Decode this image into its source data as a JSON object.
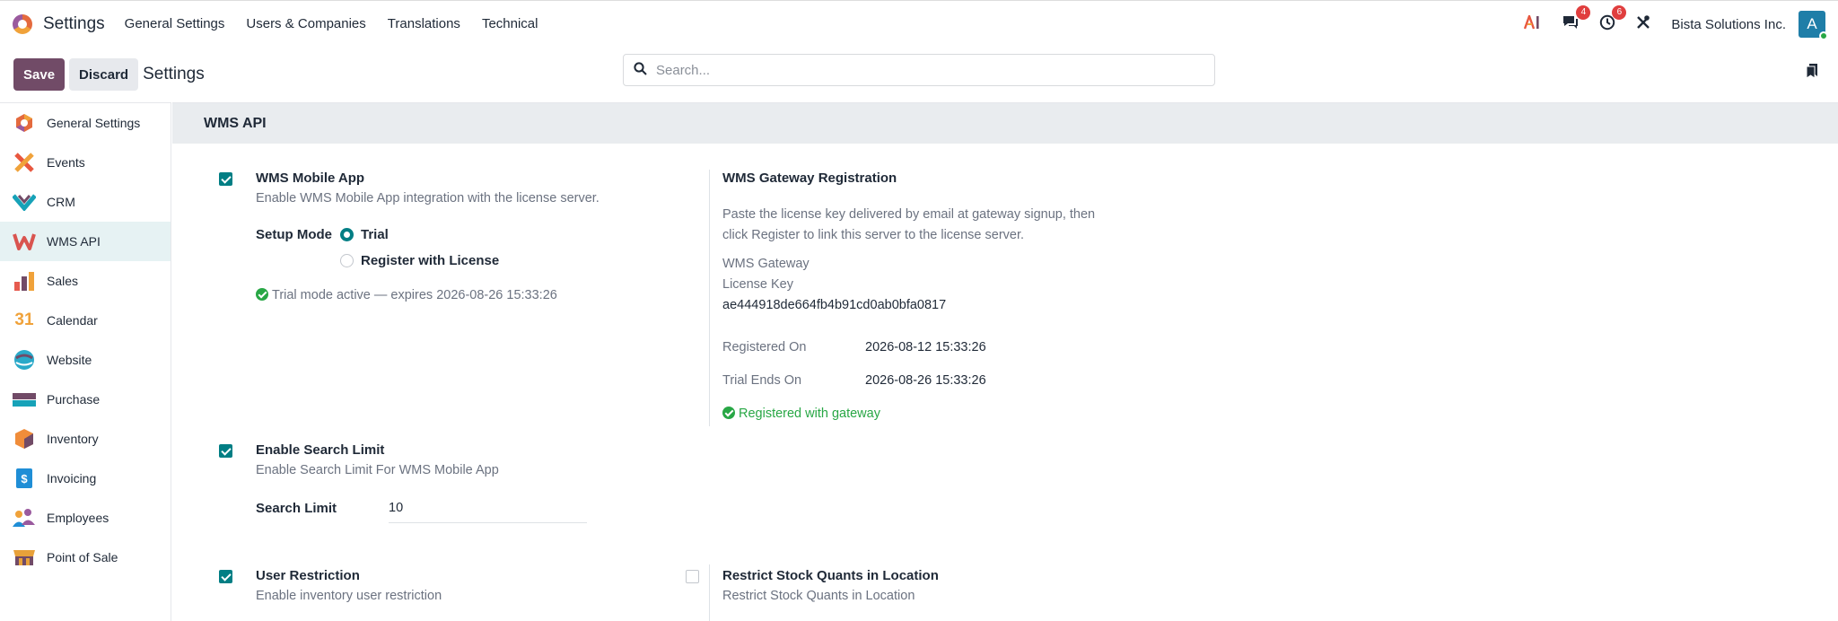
{
  "topnav": {
    "app_title": "Settings",
    "menu": [
      "General Settings",
      "Users & Companies",
      "Translations",
      "Technical"
    ],
    "messages_count": "4",
    "activities_count": "6",
    "company": "Bista Solutions Inc.",
    "avatar_letter": "A"
  },
  "control": {
    "save_label": "Save",
    "discard_label": "Discard",
    "title": "Settings",
    "search_placeholder": "Search..."
  },
  "sidebar": {
    "items": [
      {
        "label": "General Settings",
        "icon": "odoo-logo-icon",
        "color": "#e46a3e"
      },
      {
        "label": "Events",
        "icon": "events-icon",
        "color": "#e8573f"
      },
      {
        "label": "CRM",
        "icon": "crm-icon",
        "color": "#17a2b8"
      },
      {
        "label": "WMS API",
        "icon": "wms-api-icon",
        "color": "#d9544f"
      },
      {
        "label": "Sales",
        "icon": "sales-icon",
        "color": "#e65b4f"
      },
      {
        "label": "Calendar",
        "icon": "calendar-icon",
        "color": "#f0a23a"
      },
      {
        "label": "Website",
        "icon": "website-icon",
        "color": "#2aa9c9"
      },
      {
        "label": "Purchase",
        "icon": "purchase-icon",
        "color": "#714b67"
      },
      {
        "label": "Inventory",
        "icon": "inventory-icon",
        "color": "#f08d3a"
      },
      {
        "label": "Invoicing",
        "icon": "invoicing-icon",
        "color": "#1f8ed6"
      },
      {
        "label": "Employees",
        "icon": "employees-icon",
        "color": "#9a5a9e"
      },
      {
        "label": "Point of Sale",
        "icon": "point-of-sale-icon",
        "color": "#e8a13a"
      }
    ],
    "calendar_glyph": "31"
  },
  "main": {
    "section_title": "WMS API",
    "mobile_app": {
      "title": "WMS Mobile App",
      "desc": "Enable WMS Mobile App integration with the license server.",
      "setup_mode_label": "Setup Mode",
      "option_trial": "Trial",
      "option_register": "Register with License",
      "status": "Trial mode active — expires 2026-08-26 15:33:26"
    },
    "gateway": {
      "title": "WMS Gateway Registration",
      "desc_line1": "Paste the license key delivered by email at gateway signup, then",
      "desc_line2": "click Register to link this server to the license server.",
      "key_label_line1": "WMS Gateway",
      "key_label_line2": "License Key",
      "key_value": "ae444918de664fb4b91cd0ab0bfa0817",
      "registered_on_label": "Registered On",
      "registered_on_value": "2026-08-12 15:33:26",
      "trial_ends_label": "Trial Ends On",
      "trial_ends_value": "2026-08-26 15:33:26",
      "status": "Registered with gateway"
    },
    "search_limit": {
      "title": "Enable Search Limit",
      "desc": "Enable Search Limit For WMS Mobile App",
      "field_label": "Search Limit",
      "field_value": "10"
    },
    "user_restriction": {
      "title": "User Restriction",
      "desc": "Enable inventory user restriction"
    },
    "restrict_quants": {
      "title": "Restrict Stock Quants in Location",
      "desc": "Restrict Stock Quants in Location"
    }
  }
}
